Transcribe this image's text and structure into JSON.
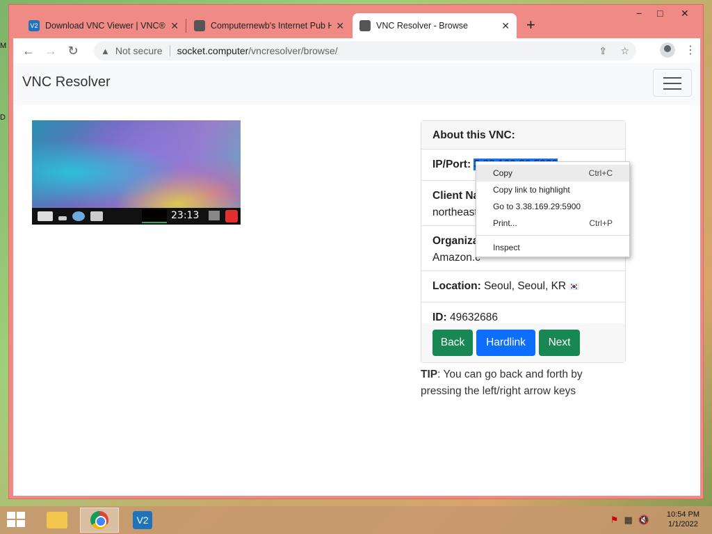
{
  "desktop": {
    "edge_letters": [
      "M",
      "D"
    ]
  },
  "browser": {
    "tabs": [
      {
        "title": "Download VNC Viewer | VNC® C",
        "icon": "vnc-icon",
        "active": false
      },
      {
        "title": "Computernewb's Internet Pub H",
        "icon": "pub-icon",
        "active": false
      },
      {
        "title": "VNC Resolver - Browse",
        "icon": "pub-icon",
        "active": true
      }
    ],
    "new_tab": "+",
    "controls": {
      "minimize": "−",
      "maximize": "□",
      "close": "✕"
    },
    "address": {
      "security": "Not secure",
      "host": "socket.computer",
      "path": "/vncresolver/browse/"
    }
  },
  "page": {
    "brand": "VNC Resolver",
    "thumbnail": {
      "clock": "23:13"
    },
    "card": {
      "header": "About this VNC:",
      "ip_label": "IP/Port:",
      "ip_value": "3.38.169.29:5900",
      "client_label": "Client Na",
      "client_value": "northeast-",
      "org_label": "Organizat",
      "org_value": "Amazon.c",
      "location_label": "Location:",
      "location_value": "Seoul, Seoul, KR",
      "flag": "🇰🇷",
      "id_label": "ID:",
      "id_value": "49632686",
      "buttons": {
        "back": "Back",
        "hardlink": "Hardlink",
        "next": "Next"
      }
    },
    "tip": {
      "bold": "TIP",
      "text": ": You can go back and forth by pressing the left/right arrow keys"
    }
  },
  "context_menu": {
    "items": [
      {
        "label": "Copy",
        "shortcut": "Ctrl+C"
      },
      {
        "label": "Copy link to highlight",
        "shortcut": ""
      },
      {
        "label": "Go to 3.38.169.29:5900",
        "shortcut": ""
      },
      {
        "label": "Print...",
        "shortcut": "Ctrl+P"
      },
      {
        "label": "Inspect",
        "shortcut": ""
      }
    ]
  },
  "taskbar": {
    "time": "10:54 PM",
    "date": "1/1/2022",
    "vnc_label": "V2"
  }
}
